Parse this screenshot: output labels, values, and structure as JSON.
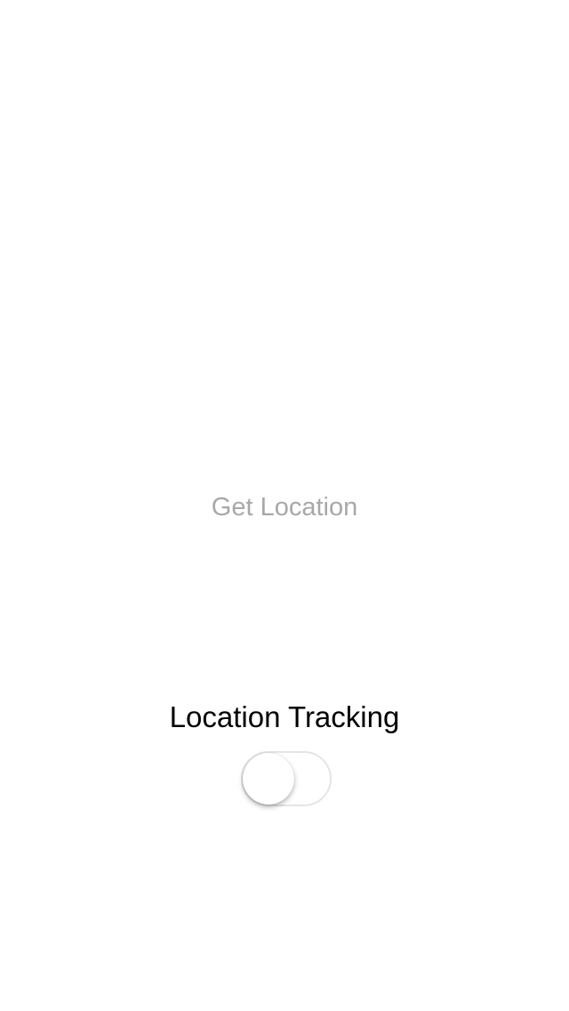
{
  "main": {
    "get_location_label": "Get Location",
    "tracking_label": "Location Tracking",
    "tracking_toggle_on": false
  },
  "colors": {
    "button_text": "#a8a8a8",
    "label_text": "#000000",
    "toggle_border": "#e5e5e5"
  }
}
